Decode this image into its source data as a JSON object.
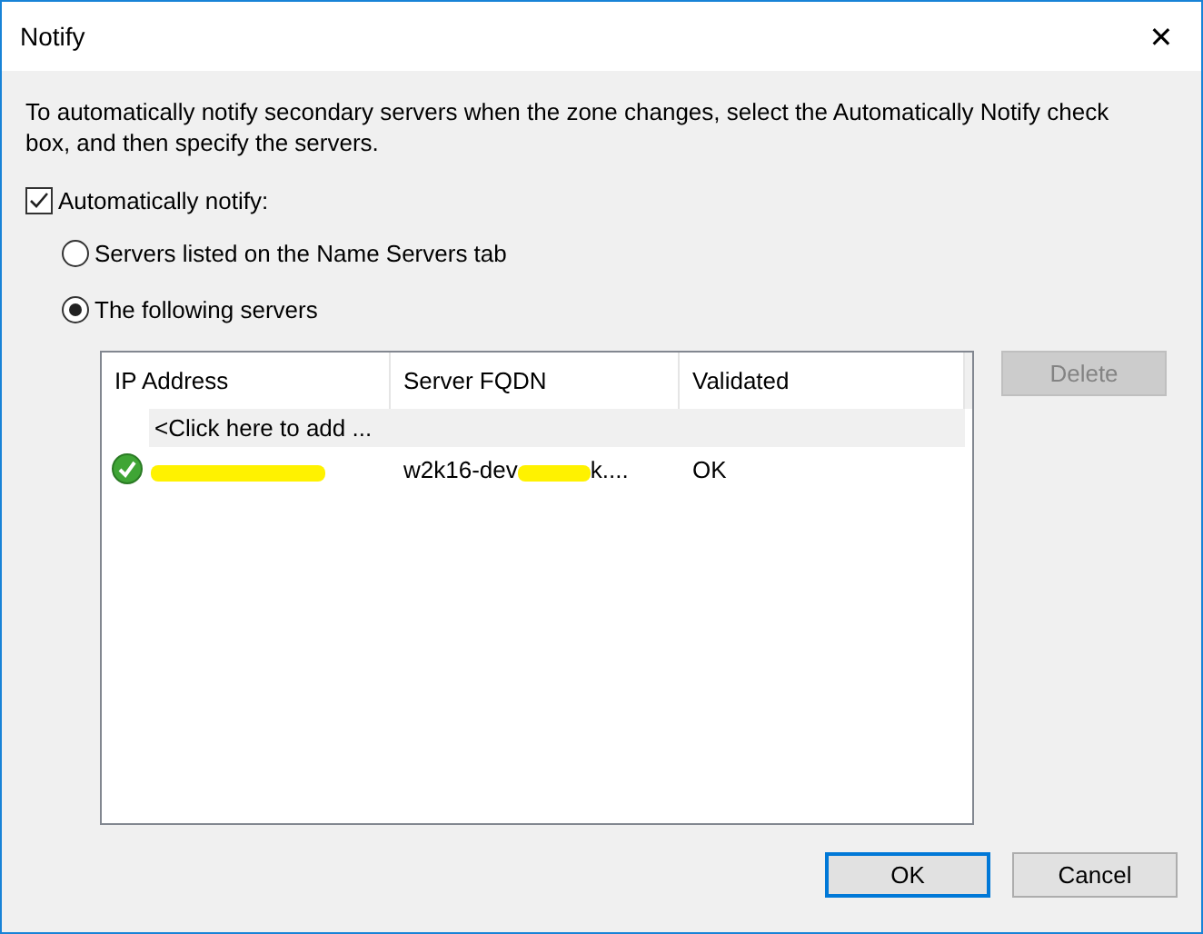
{
  "window": {
    "title": "Notify",
    "close": "✕"
  },
  "description": "To automatically notify secondary servers when the zone changes, select the Automatically Notify check box, and then specify the servers.",
  "auto_notify": {
    "label": "Automatically notify:",
    "checked": true
  },
  "options": [
    {
      "label": "Servers listed on the Name Servers tab",
      "selected": false
    },
    {
      "label": "The following servers",
      "selected": true
    }
  ],
  "table": {
    "columns": [
      "IP Address",
      "Server FQDN",
      "Validated"
    ],
    "add_row": "<Click here to add ...",
    "rows": [
      {
        "ip_redacted": true,
        "fqdn": "w2k16-dev",
        "fqdn_redacted": true,
        "fqdn_end": "k....",
        "validated": "OK",
        "valid": true
      }
    ]
  },
  "delete_button": {
    "label": "Delete",
    "disabled": true
  },
  "buttons": [
    {
      "label": "OK",
      "default": true
    },
    {
      "label": "Cancel",
      "default": false
    }
  ]
}
